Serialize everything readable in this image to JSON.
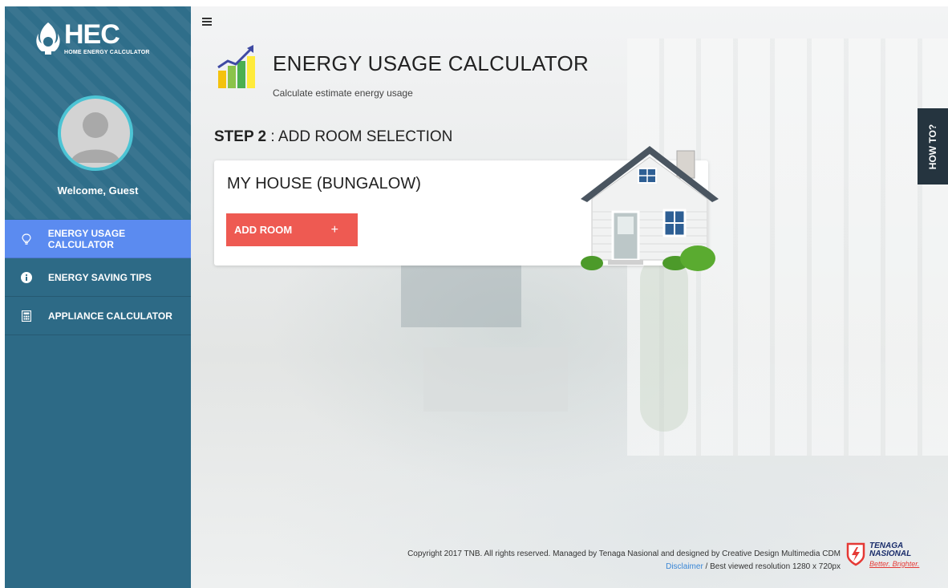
{
  "sidebar": {
    "logo_main": "HEC",
    "logo_sub": "HOME ENERGY CALCULATOR",
    "welcome": "Welcome, Guest",
    "items": [
      {
        "label": "ENERGY USAGE CALCULATOR",
        "icon": "lightbulb-icon",
        "active": true
      },
      {
        "label": "ENERGY SAVING TIPS",
        "icon": "info-icon",
        "active": false
      },
      {
        "label": "APPLIANCE CALCULATOR",
        "icon": "calculator-icon",
        "active": false
      }
    ]
  },
  "header": {
    "title": "ENERGY USAGE CALCULATOR",
    "subtitle": "Calculate estimate energy usage",
    "menu_icon": "hamburger-icon"
  },
  "step": {
    "number": "STEP 2",
    "label": " : ADD ROOM SELECTION"
  },
  "card": {
    "title": "MY HOUSE (BUNGALOW)",
    "add_room_label": "ADD ROOM",
    "add_room_icon": "+"
  },
  "howto": {
    "label": "HOW TO?"
  },
  "footer": {
    "copyright": "Copyright 2017 TNB. All rights reserved. Managed by Tenaga Nasional and designed by Creative Design Multimedia CDM",
    "disclaimer": "Disclaimer",
    "resolution": " / Best viewed resolution 1280 x 720px",
    "brand_line1": "TENAGA",
    "brand_line2": "NASIONAL",
    "brand_slogan": "Better. Brighter."
  },
  "colors": {
    "sidebar": "#2d6a86",
    "active_nav": "#5b8bf0",
    "add_button": "#ee5a52",
    "avatar_ring": "#4cc4d4",
    "howto_tab": "#25343f"
  }
}
